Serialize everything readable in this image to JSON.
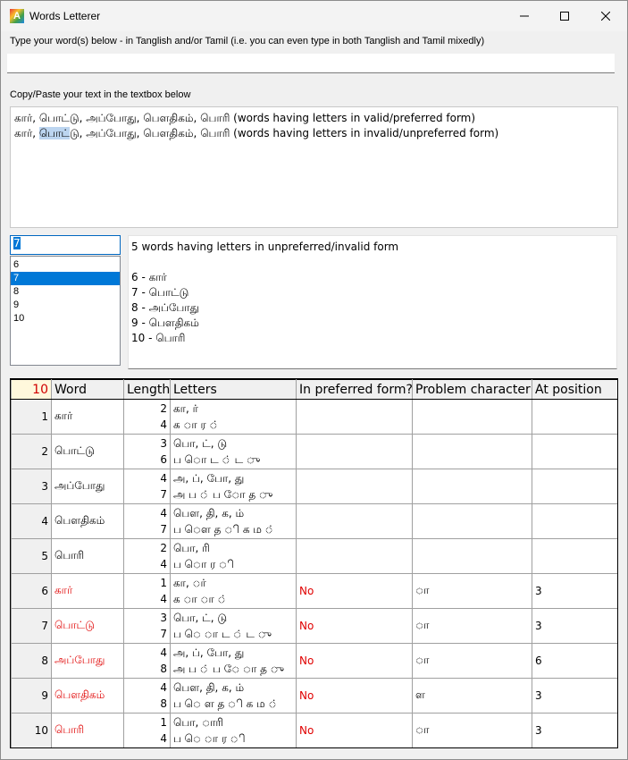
{
  "window": {
    "title": "Words Letterer"
  },
  "labels": {
    "tanglish_prompt": "Type your word(s) below - in Tanglish and/or Tamil (i.e. you can even type in both Tanglish and Tamil mixedly)",
    "copy_paste_prompt": "Copy/Paste your text in the textbox below"
  },
  "tanglish_input": {
    "value": ""
  },
  "textbox": {
    "line1": "கார், பொட்டு, அப்போது, பௌதிகம், பொரி (words having letters in valid/preferred form)",
    "line2_before": "கார், ",
    "line2_selected": "பொட்",
    "line2_after": "டு, அப்போது, பௌதிகம், பொரி (words having letters in invalid/unpreferred form)"
  },
  "number_input": {
    "value": "7"
  },
  "listbox": {
    "items": [
      "6",
      "7",
      "8",
      "9",
      "10"
    ],
    "selected": "7"
  },
  "result": {
    "summary": "5 words having letters in unpreferred/invalid form",
    "items": [
      "6 - கார்",
      "7 - பொட்டு",
      "8 - அப்போது",
      "9 - பௌதிகம்",
      "10 - பொரி"
    ]
  },
  "grid": {
    "corner": "10",
    "headers": [
      "Word",
      "Length",
      "Letters",
      "In preferred form?",
      "Problem character",
      "At position"
    ],
    "rows": [
      {
        "n": "1",
        "word": "கார்",
        "len1": "2",
        "len2": "4",
        "let1": "கா, ர்",
        "let2": "க ா ர ்",
        "pref": "",
        "prob": "",
        "pos": "",
        "invalid": false
      },
      {
        "n": "2",
        "word": "பொட்டு",
        "len1": "3",
        "len2": "6",
        "let1": "பொ, ட், டு",
        "let2": "ப ொ ட ் ட ு",
        "pref": "",
        "prob": "",
        "pos": "",
        "invalid": false
      },
      {
        "n": "3",
        "word": "அப்போது",
        "len1": "4",
        "len2": "7",
        "let1": "அ, ப், போ, து",
        "let2": "அ ப ் ப ோ த ு",
        "pref": "",
        "prob": "",
        "pos": "",
        "invalid": false
      },
      {
        "n": "4",
        "word": "பௌதிகம்",
        "len1": "4",
        "len2": "7",
        "let1": "பௌ, தி, க, ம்",
        "let2": "ப ௌ த ி க ம ்",
        "pref": "",
        "prob": "",
        "pos": "",
        "invalid": false
      },
      {
        "n": "5",
        "word": "பொரி",
        "len1": "2",
        "len2": "4",
        "let1": "பொ, ரி",
        "let2": "ப ொ ர ி",
        "pref": "",
        "prob": "",
        "pos": "",
        "invalid": false
      },
      {
        "n": "6",
        "word": "கார்",
        "len1": "1",
        "len2": "4",
        "let1": "கா, ா்",
        "let2": "க ா ா ்",
        "pref": "No",
        "prob": "ா",
        "pos": "3",
        "invalid": true
      },
      {
        "n": "7",
        "word": "பொட்டு",
        "len1": "3",
        "len2": "7",
        "let1": "பொ, ட், டு",
        "let2": "ப ெ ா ட ் ட ு",
        "pref": "No",
        "prob": "ா",
        "pos": "3",
        "invalid": true
      },
      {
        "n": "8",
        "word": "அப்போது",
        "len1": "4",
        "len2": "8",
        "let1": "அ, ப், போ, து",
        "let2": "அ ப ் ப ே ா த ு",
        "pref": "No",
        "prob": "ா",
        "pos": "6",
        "invalid": true
      },
      {
        "n": "9",
        "word": "பௌதிகம்",
        "len1": "4",
        "len2": "8",
        "let1": "பௌ, தி, க, ம்",
        "let2": "ப ெ ள த ி க ம ்",
        "pref": "No",
        "prob": "ள",
        "pos": "3",
        "invalid": true
      },
      {
        "n": "10",
        "word": "பொரி",
        "len1": "1",
        "len2": "4",
        "let1": "பொ, ாரி",
        "let2": "ப ெ ா ர ி",
        "pref": "No",
        "prob": "ா",
        "pos": "3",
        "invalid": true
      }
    ]
  },
  "colors": {
    "invalid_text": "#e00000",
    "selection": "#0078d7"
  }
}
